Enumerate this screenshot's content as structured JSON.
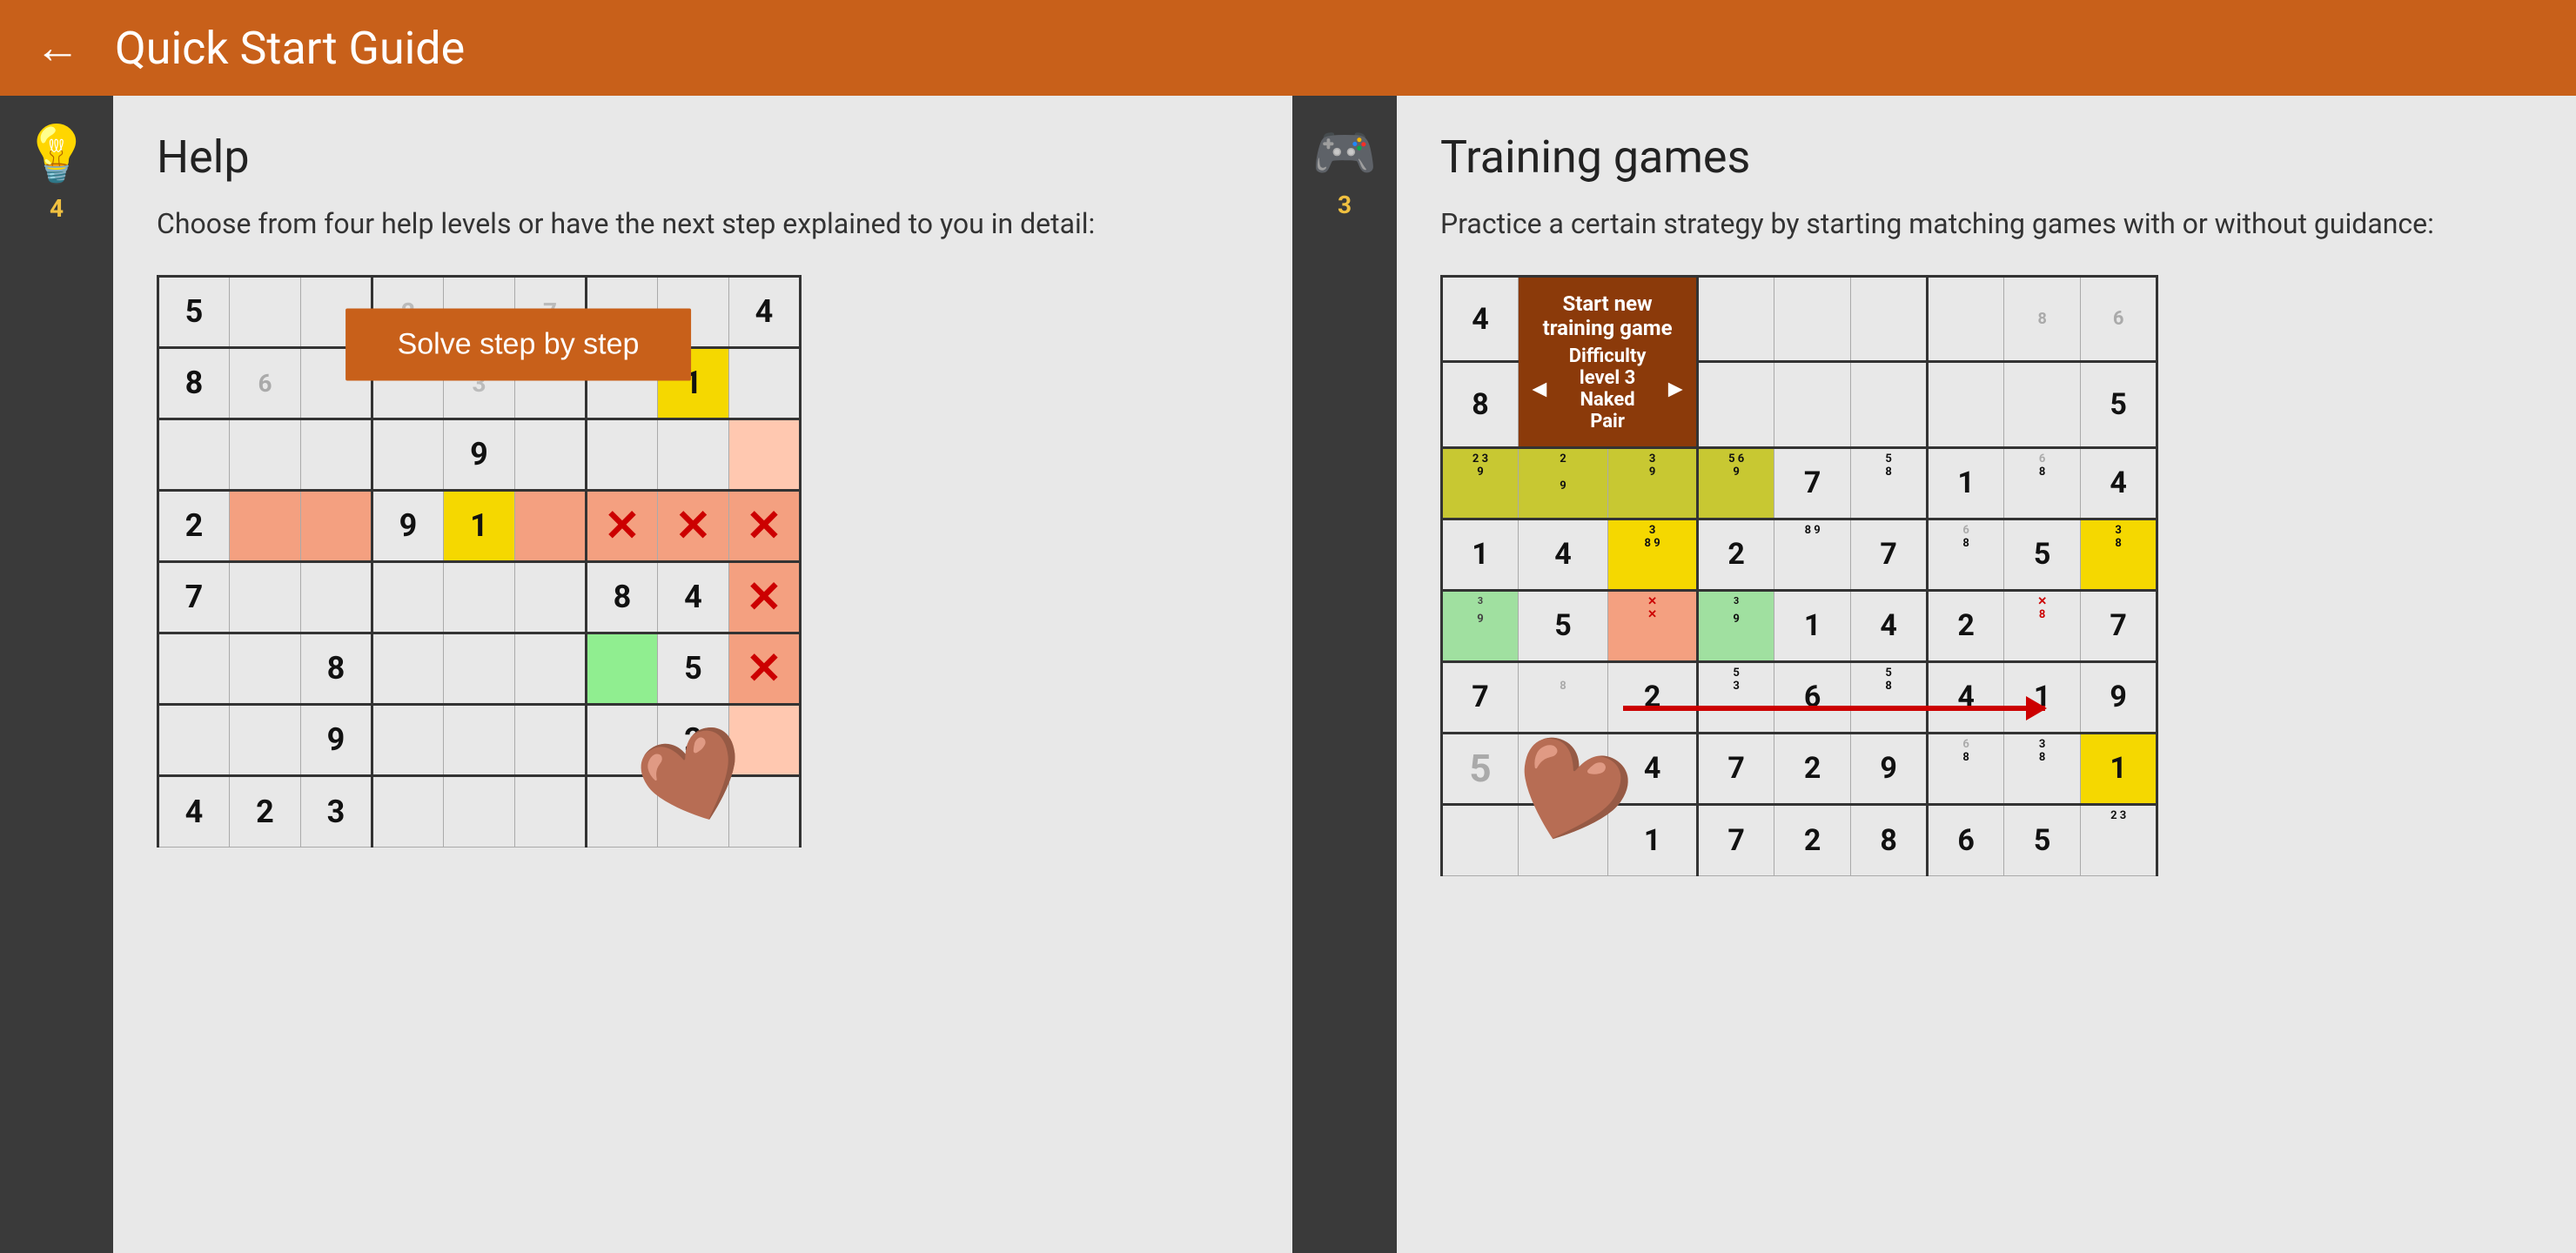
{
  "header": {
    "back_label": "←",
    "title": "Quick Start Guide"
  },
  "left_panel": {
    "icon": "💡",
    "badge": "4",
    "section_title": "Help",
    "description": "Choose from four help levels or have the next step explained to you in detail:",
    "solve_button": "Solve step by step"
  },
  "right_panel": {
    "icon": "🎮",
    "badge": "3",
    "section_title": "Training games",
    "description": "Practice a certain strategy by starting matching games with or without guidance:",
    "training": {
      "title": "Start new training game",
      "subtitle": "Difficulty level 3",
      "game_name": "Naked Pair",
      "prev_label": "◄",
      "next_label": "►"
    }
  }
}
